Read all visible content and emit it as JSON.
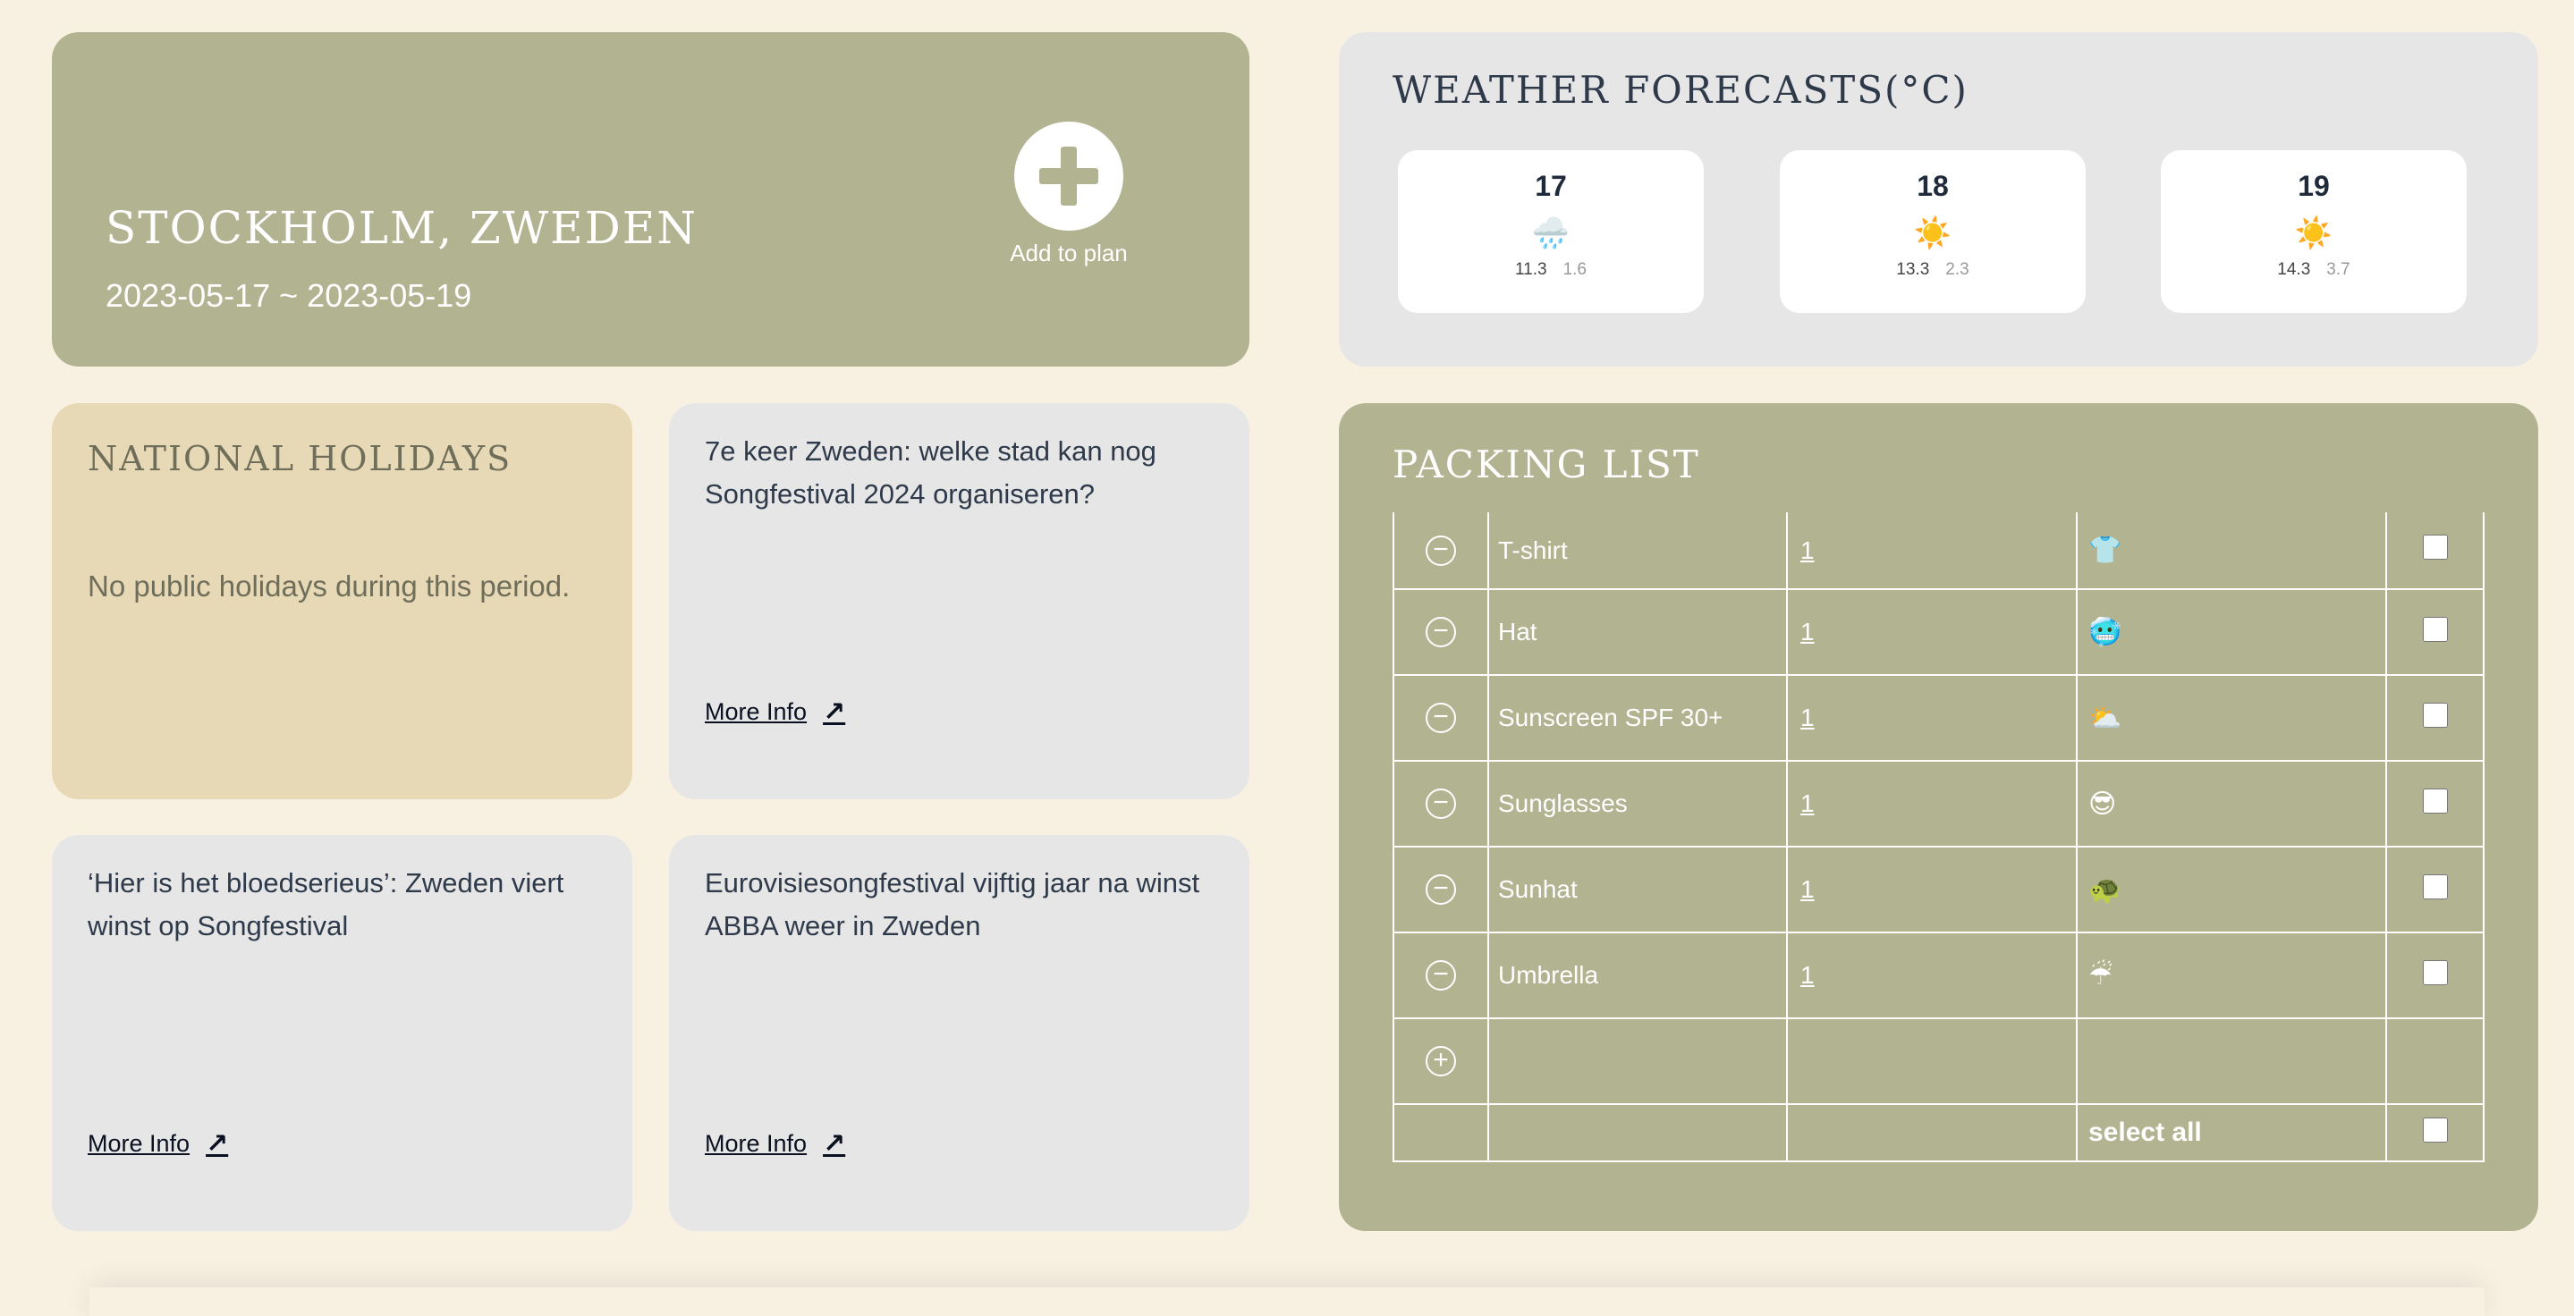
{
  "city": {
    "title": "STOCKHOLM, ZWEDEN",
    "dates": "2023-05-17 ~ 2023-05-19",
    "add_label": "Add to plan"
  },
  "weather": {
    "title": "WEATHER FORECASTS(°C)",
    "days": [
      {
        "date": "17",
        "icon": "rain-cloud-icon",
        "glyph": "🌧️",
        "hi": "11.3",
        "lo": "1.6"
      },
      {
        "date": "18",
        "icon": "sun-icon",
        "glyph": "☀️",
        "hi": "13.3",
        "lo": "2.3"
      },
      {
        "date": "19",
        "icon": "sun-icon",
        "glyph": "☀️",
        "hi": "14.3",
        "lo": "3.7"
      }
    ]
  },
  "holidays": {
    "title": "NATIONAL HOLIDAYS",
    "text": "No public holidays during this period."
  },
  "news": [
    {
      "headline": "7e keer Zweden: welke stad kan nog Songfestival 2024 organiseren?",
      "more": "More Info"
    },
    {
      "headline": "‘Hier is het bloedserieus’: Zweden viert winst op Songfestival",
      "more": "More Info"
    },
    {
      "headline": "Eurovisiesongfestival vijftig jaar na winst ABBA weer in Zweden",
      "more": "More Info"
    }
  ],
  "packing": {
    "title": "PACKING LIST",
    "items": [
      {
        "name": "T-shirt",
        "qty": "1",
        "icon": "tshirt-icon",
        "glyph": "👕"
      },
      {
        "name": "Hat",
        "qty": "1",
        "icon": "cold-face-icon",
        "glyph": "🥶"
      },
      {
        "name": "Sunscreen SPF 30+",
        "qty": "1",
        "icon": "sun-behind-cloud-icon",
        "glyph": "⛅"
      },
      {
        "name": "Sunglasses",
        "qty": "1",
        "icon": "sunglasses-face-icon",
        "glyph": "😎"
      },
      {
        "name": "Sunhat",
        "qty": "1",
        "icon": "turtle-icon",
        "glyph": "🐢"
      },
      {
        "name": "Umbrella",
        "qty": "1",
        "icon": "umbrella-rain-icon",
        "glyph": "☔"
      }
    ],
    "select_all": "select all"
  }
}
